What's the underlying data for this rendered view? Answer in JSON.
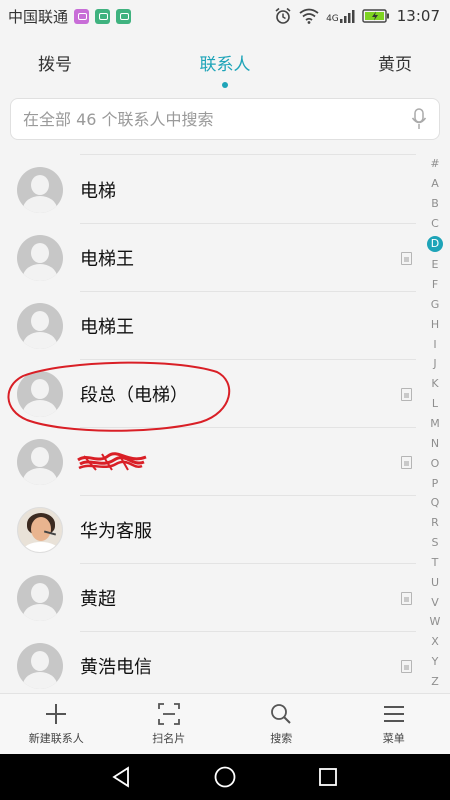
{
  "status": {
    "carrier": "中国联通",
    "network": "4G",
    "time": "13:07"
  },
  "tabs": [
    {
      "label": "拨号",
      "active": false
    },
    {
      "label": "联系人",
      "active": true
    },
    {
      "label": "黄页",
      "active": false
    }
  ],
  "search": {
    "placeholder": "在全部 46 个联系人中搜索",
    "value": ""
  },
  "contacts": [
    {
      "name": "电梯",
      "sim_icon": false,
      "avatar": "default-avatar"
    },
    {
      "name": "电梯王",
      "sim_icon": true,
      "avatar": "default-avatar"
    },
    {
      "name": "电梯王",
      "sim_icon": false,
      "avatar": "default-avatar"
    },
    {
      "name": "段总（电梯）",
      "sim_icon": true,
      "avatar": "default-avatar",
      "annotated": true
    },
    {
      "name": "",
      "sim_icon": true,
      "avatar": "default-avatar",
      "scribbled": true
    },
    {
      "name": "华为客服",
      "sim_icon": false,
      "avatar": "photo-avatar"
    },
    {
      "name": "黄超",
      "sim_icon": true,
      "avatar": "default-avatar"
    },
    {
      "name": "黄浩电信",
      "sim_icon": true,
      "avatar": "default-avatar"
    }
  ],
  "alphabet": [
    "#",
    "A",
    "B",
    "C",
    "D",
    "E",
    "F",
    "G",
    "H",
    "I",
    "J",
    "K",
    "L",
    "M",
    "N",
    "O",
    "P",
    "Q",
    "R",
    "S",
    "T",
    "U",
    "V",
    "W",
    "X",
    "Y",
    "Z"
  ],
  "alphabet_active": "D",
  "actions": [
    {
      "label": "新建联系人",
      "icon": "plus-icon"
    },
    {
      "label": "扫名片",
      "icon": "scan-card-icon"
    },
    {
      "label": "搜索",
      "icon": "search-icon"
    },
    {
      "label": "菜单",
      "icon": "menu-icon"
    }
  ],
  "colors": {
    "accent": "#1ea4b8",
    "annotation": "#d91f26"
  }
}
